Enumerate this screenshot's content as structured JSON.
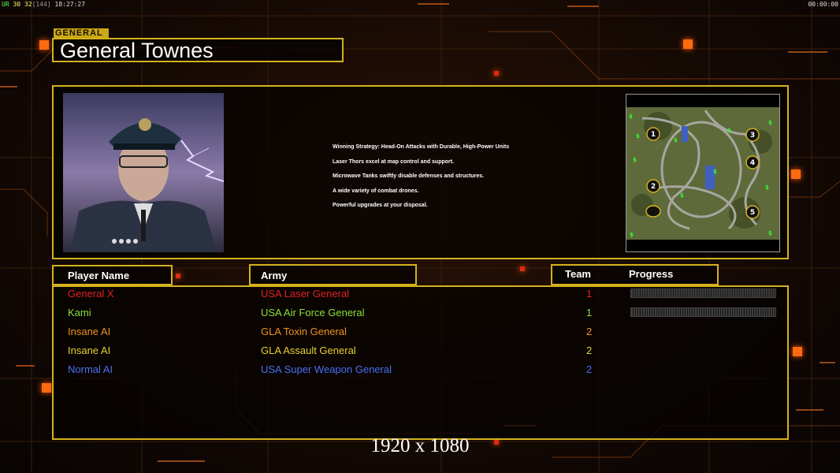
{
  "hud": {
    "left_prefix": "UR",
    "left_fps": "30",
    "left_fps2": "32",
    "left_frames": "[144]",
    "left_time": "18:27:27",
    "right_time": "00:00:00"
  },
  "general": {
    "tag": "GENERAL",
    "name": "General Townes"
  },
  "strategy": [
    "Winning Strategy: Head-On Attacks with Durable, High-Power Units",
    "Laser Thors excel at map control and support.",
    "Microwave Tanks swiftly disable defenses and structures.",
    "A wide variety of combat drones.",
    "Powerful upgrades at your disposal."
  ],
  "minimap": {
    "start_positions": [
      "1",
      "2",
      "3",
      "4",
      "5"
    ]
  },
  "table": {
    "headers": {
      "player": "Player Name",
      "army": "Army",
      "team": "Team",
      "progress": "Progress"
    },
    "rows": [
      {
        "player": "General X",
        "army": "USA Laser General",
        "team": "1",
        "color": "#e02020",
        "progress": 0.0
      },
      {
        "player": "Kami",
        "army": "USA Air Force General",
        "team": "1",
        "color": "#8ce03a",
        "progress": 0.0
      },
      {
        "player": "Insane AI",
        "army": "GLA Toxin General",
        "team": "2",
        "color": "#f09020",
        "progress": null
      },
      {
        "player": "Insane AI",
        "army": "GLA Assault General",
        "team": "2",
        "color": "#e8d030",
        "progress": null
      },
      {
        "player": "Normal AI",
        "army": "USA Super Weapon General",
        "team": "2",
        "color": "#4a70f0",
        "progress": null
      }
    ]
  },
  "resolution": "1920 x 1080",
  "colors": {
    "frame": "#d4b21c",
    "accent": "#ff6a10"
  }
}
